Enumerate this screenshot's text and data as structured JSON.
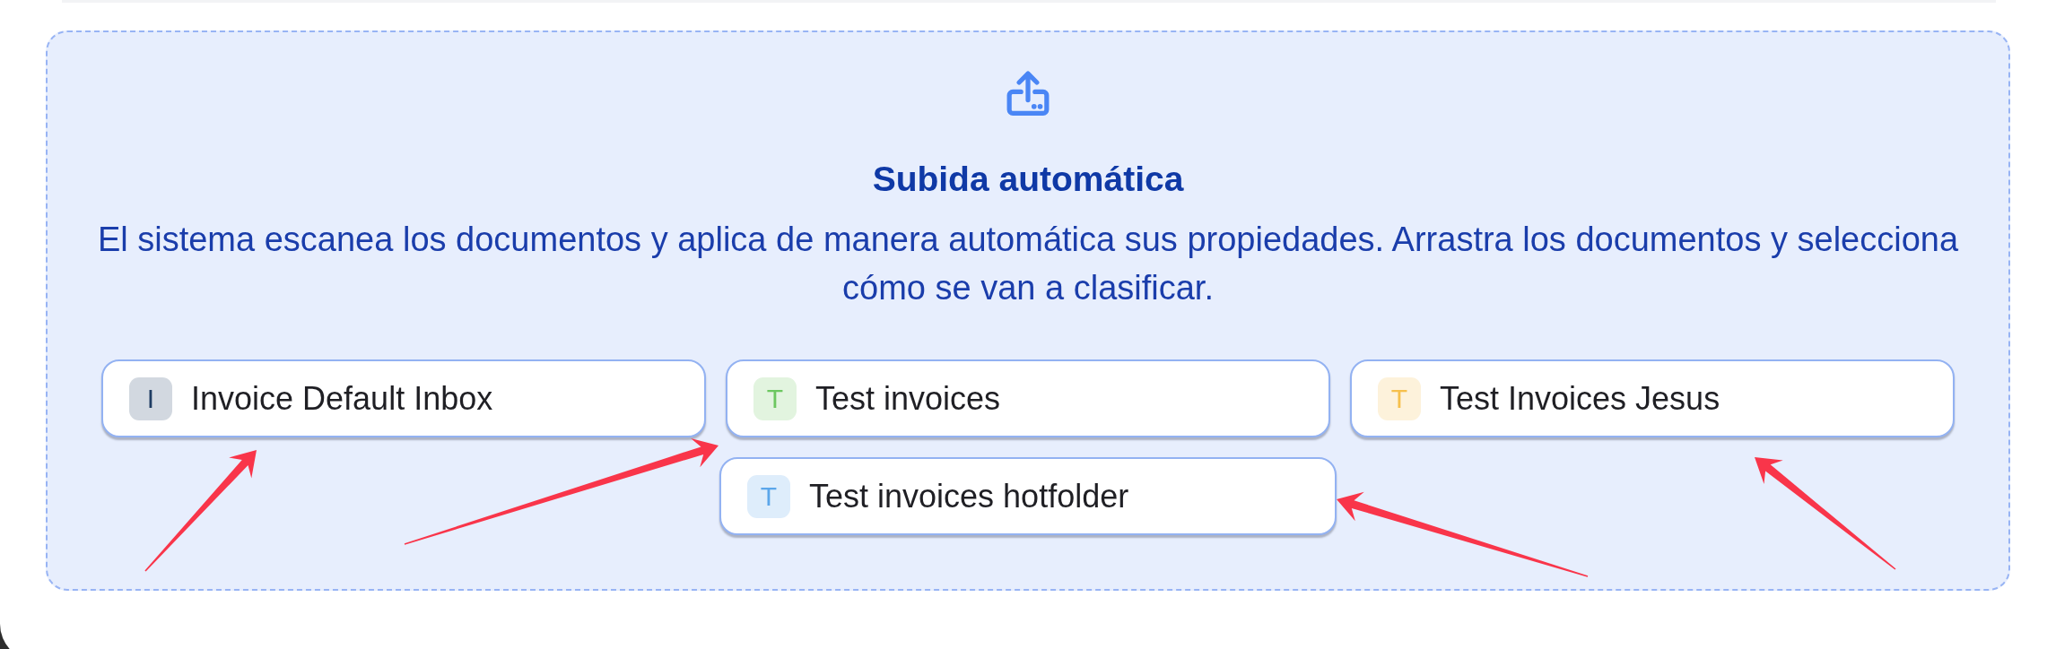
{
  "upload": {
    "title": "Subida automática",
    "description": "El sistema escanea los documentos y aplica de manera automática sus propiedades. Arrastra los documentos y selecciona cómo se van a clasificar."
  },
  "folders": [
    {
      "initial": "I",
      "label": "Invoice Default Inbox",
      "color": "#1f3d63"
    },
    {
      "initial": "T",
      "label": "Test invoices",
      "color": "#6cc760"
    },
    {
      "initial": "T",
      "label": "Test Invoices Jesus",
      "color": "#f6c04c"
    },
    {
      "initial": "T",
      "label": "Test invoices hotfolder",
      "color": "#5ba6ea"
    }
  ]
}
